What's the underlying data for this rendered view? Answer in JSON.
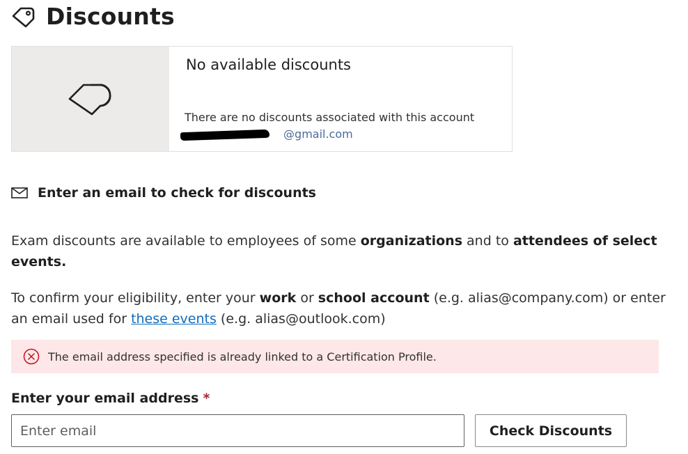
{
  "header": {
    "title": "Discounts",
    "icon": "tag-icon"
  },
  "card": {
    "image_icon": "tag-icon",
    "title": "No available discounts",
    "description": "There are no discounts associated with this account",
    "email_suffix": "@gmail.com",
    "email_redacted": true
  },
  "section": {
    "icon": "mail-icon",
    "heading": "Enter an email to check for discounts"
  },
  "para1": {
    "t1": "Exam discounts are available to employees of some ",
    "b1": "organizations",
    "t2": " and to ",
    "b2": "attendees of select events."
  },
  "para2": {
    "t1": "To confirm your eligibility, enter your ",
    "b1": "work",
    "t2": " or ",
    "b2": "school account",
    "t3": " (e.g. alias@company.com) or enter an email used for ",
    "link": "these events",
    "t4": " (e.g. alias@outlook.com)"
  },
  "error": {
    "icon": "error-circle-icon",
    "message": "The email address specified is already linked to a Certification Profile.",
    "background": "#fde7e9",
    "icon_color": "#c50f1f"
  },
  "form": {
    "label": "Enter your email address",
    "required_marker": "*",
    "email_placeholder": "Enter email",
    "email_value": "",
    "submit_label": "Check Discounts"
  },
  "colors": {
    "link": "#0f6cbd",
    "text": "#323130",
    "card_image_bg": "#edebe9"
  }
}
